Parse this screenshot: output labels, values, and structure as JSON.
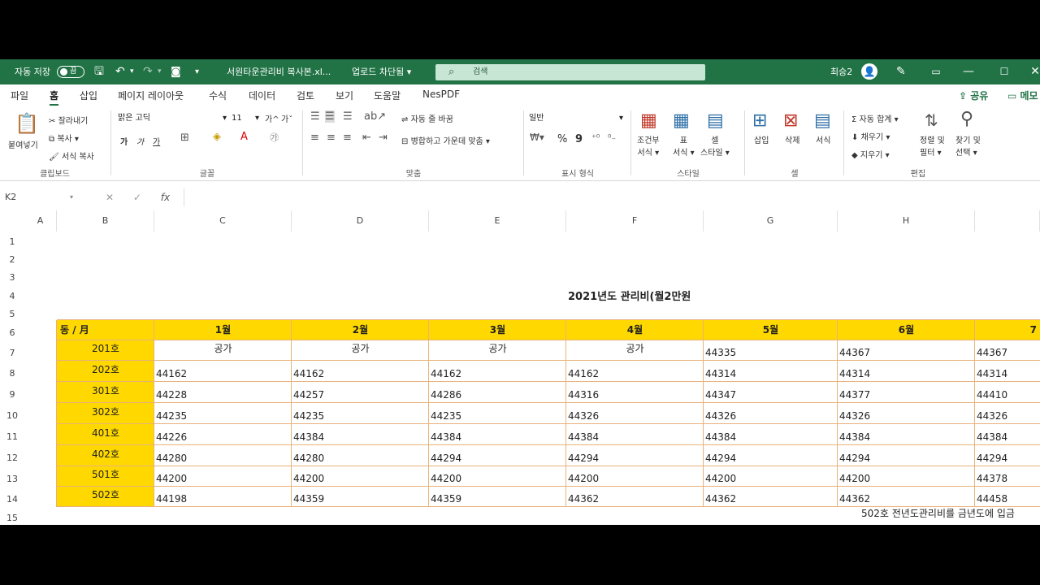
{
  "titlebar": {
    "autosave_label": "자동 저장",
    "autosave_state": "끔",
    "filename": "서원타운관리비 복사본.xl...",
    "upload_status": "업로드 차단됨 ▾",
    "search_placeholder": "검색",
    "user": "최승2",
    "bg_color": "#217346"
  },
  "tabs": [
    "파일",
    "홈",
    "삽입",
    "페이지 레이아웃",
    "수식",
    "데이터",
    "검토",
    "보기",
    "도움말",
    "NesPDF"
  ],
  "active_tab": "홈",
  "share_label": "공유",
  "memo_label": "메모",
  "ribbon": {
    "clipboard": {
      "paste": "붙여넣기",
      "cut": "잘라내기",
      "copy": "복사 ▾",
      "format_painter": "서식 복사",
      "label": "클립보드"
    },
    "font": {
      "name": "맑은 고딕",
      "size": "11",
      "label": "글꼴",
      "bold": "가",
      "italic": "가",
      "underline": "가",
      "grow": "가^",
      "shrink": "가ˇ"
    },
    "align": {
      "wrap": "자동 줄 바꿈",
      "merge": "병합하고 가운데 맞춤",
      "label": "맞춤"
    },
    "number": {
      "format": "일반",
      "label": "표시 형식",
      "percent": "%",
      "comma": "9"
    },
    "styles": {
      "cond": "조건부\n서식 ▾",
      "table": "표\n서식 ▾",
      "cell": "셀\n스타일 ▾",
      "label": "스타일"
    },
    "cells": {
      "insert": "삽입",
      "delete": "삭제",
      "format": "서식",
      "label": "셀"
    },
    "editing": {
      "autosum": "자동 합계",
      "fill": "채우기",
      "clear": "지우기",
      "sort": "정렬 및\n필터 ▾",
      "find": "찾기 및\n선택 ▾",
      "label": "편집"
    }
  },
  "formula_bar": {
    "name_box": "K2",
    "cancel": "✕",
    "enter": "✓",
    "fx": "fx",
    "value": ""
  },
  "columns": [
    "A",
    "B",
    "C",
    "D",
    "E",
    "F",
    "G",
    "H"
  ],
  "rows": [
    "1",
    "2",
    "3",
    "4",
    "5",
    "6",
    "7",
    "8",
    "9",
    "10",
    "11",
    "12",
    "13",
    "14",
    "15"
  ],
  "sheet": {
    "title": "2021년도 관리비(월2만원",
    "header_corner": "동 / 月",
    "months": [
      "1월",
      "2월",
      "3월",
      "4월",
      "5월",
      "6월",
      "7"
    ],
    "units": [
      "201호",
      "202호",
      "301호",
      "302호",
      "401호",
      "402호",
      "501호",
      "502호"
    ],
    "data": [
      [
        "공가",
        "공가",
        "공가",
        "공가",
        "44335",
        "44367",
        "44367"
      ],
      [
        "44162",
        "44162",
        "44162",
        "44162",
        "44314",
        "44314",
        "44314"
      ],
      [
        "44228",
        "44257",
        "44286",
        "44316",
        "44347",
        "44377",
        "44410"
      ],
      [
        "44235",
        "44235",
        "44235",
        "44326",
        "44326",
        "44326",
        "44326"
      ],
      [
        "44226",
        "44384",
        "44384",
        "44384",
        "44384",
        "44384",
        "44384"
      ],
      [
        "44280",
        "44280",
        "44294",
        "44294",
        "44294",
        "44294",
        "44294"
      ],
      [
        "44200",
        "44200",
        "44200",
        "44200",
        "44200",
        "44200",
        "44378"
      ],
      [
        "44198",
        "44359",
        "44359",
        "44362",
        "44362",
        "44362",
        "44458"
      ]
    ],
    "note": "502호 전년도관리비를 금년도에 입금",
    "header_color": "#ffd800"
  }
}
